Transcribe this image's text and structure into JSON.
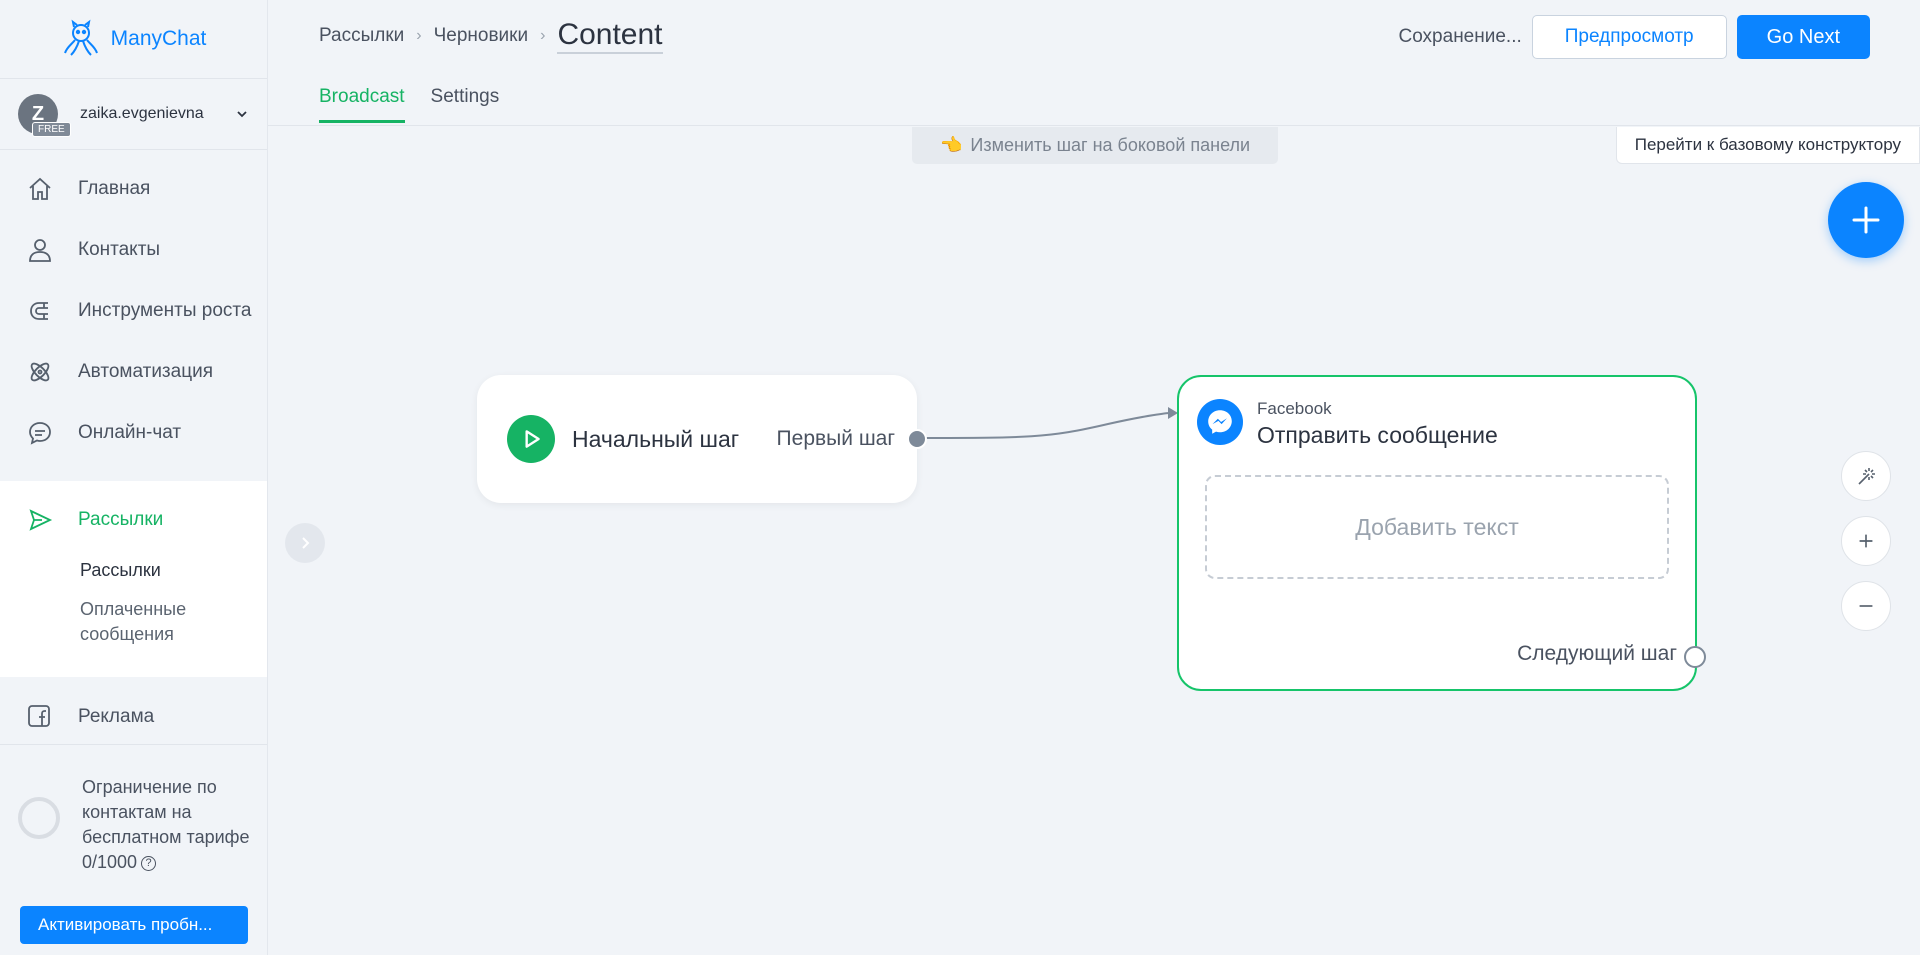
{
  "brand": {
    "name": "ManyChat",
    "color": "#0b84ff"
  },
  "account": {
    "initial": "Z",
    "badge": "FREE",
    "name": "zaika.evgenievna"
  },
  "nav": {
    "items": [
      {
        "label": "Главная",
        "icon": "home-icon"
      },
      {
        "label": "Контакты",
        "icon": "user-icon"
      },
      {
        "label": "Инструменты роста",
        "icon": "magnet-icon"
      },
      {
        "label": "Автоматизация",
        "icon": "atom-icon"
      },
      {
        "label": "Онлайн-чат",
        "icon": "chat-icon"
      }
    ],
    "active": {
      "label": "Рассылки",
      "icon": "send-icon",
      "sub": [
        "Рассылки",
        "Оплаченные сообщения"
      ]
    },
    "ads": {
      "label": "Реклама",
      "icon": "facebook-icon"
    }
  },
  "limit": {
    "text": "Ограничение по контактам на бесплатном тарифе",
    "count": "0/1000"
  },
  "activate_label": "Активировать пробн...",
  "header": {
    "breadcrumb": [
      "Рассылки",
      "Черновики"
    ],
    "current": "Content",
    "tabs": [
      "Broadcast",
      "Settings"
    ],
    "saving": "Сохранение...",
    "preview": "Предпросмотр",
    "next": "Go Next"
  },
  "canvas": {
    "hint": "Изменить шаг на боковой панели",
    "basic_builder": "Перейти к базовому конструктору",
    "start_node": {
      "title": "Начальный шаг",
      "output": "Первый шаг"
    },
    "message_node": {
      "channel": "Facebook",
      "title": "Отправить сообщение",
      "add_text": "Добавить текст",
      "next": "Следующий шаг"
    }
  },
  "colors": {
    "accent_green": "#16b364",
    "primary_blue": "#0b84ff"
  }
}
